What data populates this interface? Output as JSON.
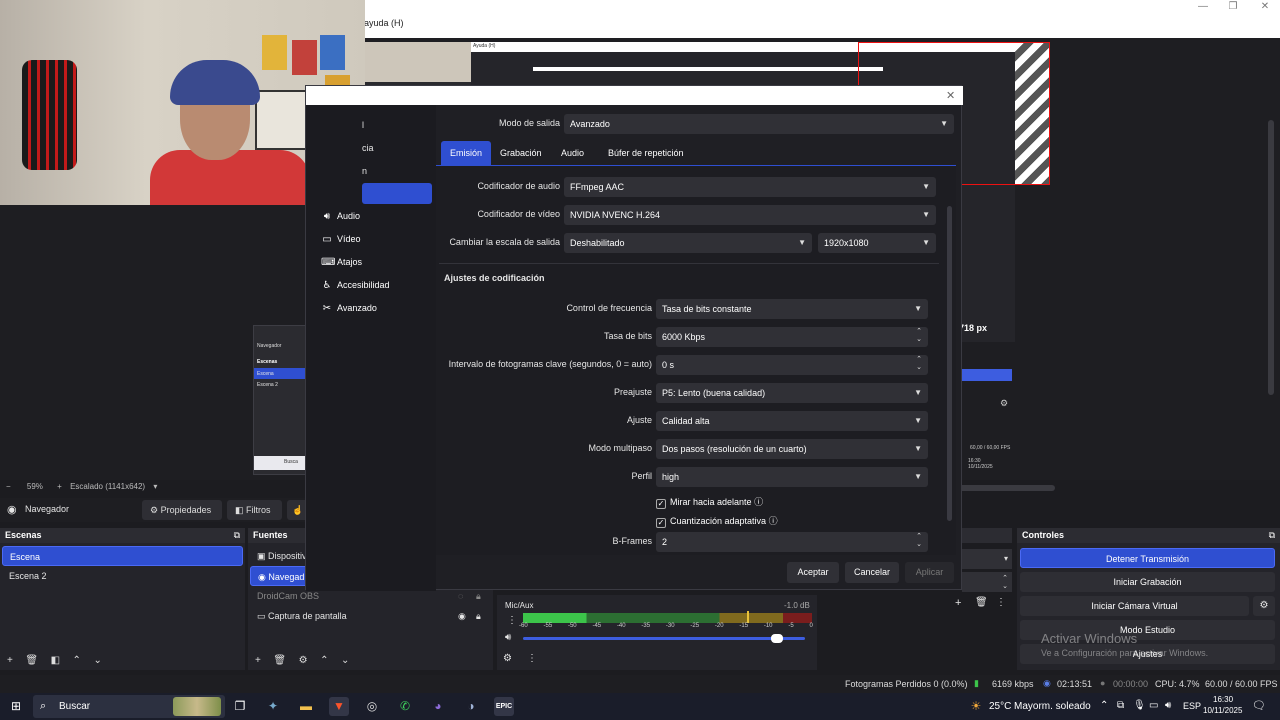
{
  "menubar": {
    "help": "ayuda (H)"
  },
  "preview": {
    "resolution_text": "718 px",
    "zoom": "59%",
    "scale_text": "Escalado (1141x642)"
  },
  "mini_preview": {
    "title": "Navegador",
    "header": "Escenas",
    "items": [
      "Escena",
      "Escena 2"
    ],
    "search": "Busca"
  },
  "preview_inner": {
    "fps": "60,00 / 60,00 FPS",
    "time": "16:30",
    "date": "10/11/2025",
    "menu": "Ayuda (H)"
  },
  "nav": {
    "source": "Navegador",
    "properties": "Propiedades",
    "filters": "Filtros"
  },
  "scenes": {
    "title": "Escenas",
    "items": [
      "Escena",
      "Escena 2"
    ]
  },
  "sources": {
    "title": "Fuentes",
    "items": [
      "Dispositiv",
      "Navegad",
      "DroidCam OBS",
      "Captura de pantalla"
    ]
  },
  "mixer": {
    "track": "Mic/Aux",
    "level": "-1.0 dB",
    "ticks": [
      "-60",
      "-55",
      "-50",
      "-45",
      "-40",
      "-35",
      "-30",
      "-25",
      "-20",
      "-15",
      "-10",
      "-5",
      "0"
    ],
    "volume": 0.9
  },
  "controls": {
    "title": "Controles",
    "stop_stream": "Detener Transmisión",
    "start_recording": "Iniciar Grabación",
    "start_virtual_cam": "Iniciar Cámara Virtual",
    "studio_mode": "Modo Estudio",
    "settings": "Ajustes",
    "watermark_title": "Activar Windows",
    "watermark_sub": "Ve a Configuración para activar Windows."
  },
  "dialog": {
    "sidebar": [
      {
        "label": "Audio",
        "icon": "speaker-icon"
      },
      {
        "label": "Vídeo",
        "icon": "monitor-icon"
      },
      {
        "label": "Atajos",
        "icon": "keyboard-icon"
      },
      {
        "label": "Accesibilidad",
        "icon": "accessibility-icon"
      },
      {
        "label": "Avanzado",
        "icon": "wrench-icon"
      }
    ],
    "sidebar_partial": [
      "l",
      "cia",
      "n"
    ],
    "output_mode_label": "Modo de salida",
    "output_mode": "Avanzado",
    "tabs": [
      "Emisión",
      "Grabación",
      "Audio",
      "Búfer de repetición"
    ],
    "audio_encoder_label": "Codificador de audio",
    "audio_encoder": "FFmpeg AAC",
    "video_encoder_label": "Codificador de vídeo",
    "video_encoder": "NVIDIA NVENC H.264",
    "rescale_label": "Cambiar la escala de salida",
    "rescale": "Deshabilitado",
    "rescale_res": "1920x1080",
    "section_title": "Ajustes de codificación",
    "rate_control_label": "Control de frecuencia",
    "rate_control": "Tasa de bits constante",
    "bitrate_label": "Tasa de bits",
    "bitrate": "6000 Kbps",
    "keyframe_label": "Intervalo de fotogramas clave (segundos, 0 = auto)",
    "keyframe": "0 s",
    "preset_label": "Preajuste",
    "preset": "P5: Lento (buena calidad)",
    "tuning_label": "Ajuste",
    "tuning": "Calidad alta",
    "multipass_label": "Modo multipaso",
    "multipass": "Dos pasos (resolución de un cuarto)",
    "profile_label": "Perfil",
    "profile": "high",
    "lookahead": "Mirar hacia adelante",
    "adaptive_quant": "Cuantización adaptativa",
    "bframes_label": "B-Frames",
    "bframes": "2",
    "accept": "Aceptar",
    "cancel": "Cancelar",
    "apply": "Aplicar"
  },
  "status": {
    "dropped": "Fotogramas Perdidos 0 (0.0%)",
    "kbps": "6169 kbps",
    "stream_time": "02:13:51",
    "rec_time": "00:00:00",
    "cpu": "CPU: 4.7%",
    "fps": "60.00 / 60.00 FPS"
  },
  "taskbar": {
    "search": "Buscar",
    "temp": "25°C",
    "weather": "Mayorm. soleado",
    "lang": "ESP",
    "time": "16:30",
    "date": "10/11/2025"
  }
}
